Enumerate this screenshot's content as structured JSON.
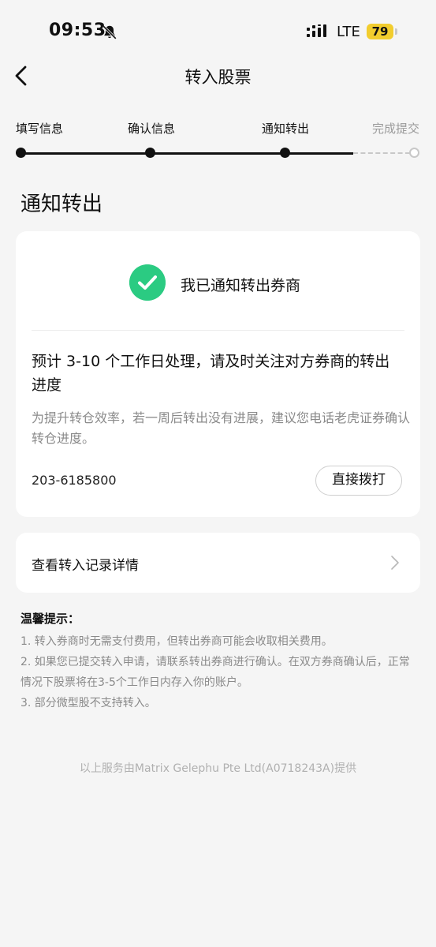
{
  "status_bar": {
    "time": "09:53",
    "network": "LTE",
    "battery": "79"
  },
  "nav": {
    "title": "转入股票"
  },
  "steps": [
    {
      "label": "填写信息",
      "state": "done"
    },
    {
      "label": "确认信息",
      "state": "done"
    },
    {
      "label": "通知转出",
      "state": "current"
    },
    {
      "label": "完成提交",
      "state": "pending"
    }
  ],
  "section_title": "通知转出",
  "notice_card": {
    "confirm_text": "我已通知转出券商",
    "headline": "预计 3-10 个工作日处理，请及时关注对方券商的转出进度",
    "description": "为提升转仓效率，若一周后转出没有进展，建议您电话老虎证券确认转仓进度。",
    "phone": "203-6185800",
    "call_button": "直接拨打"
  },
  "record_link": {
    "label": "查看转入记录详情"
  },
  "tips": {
    "title": "温馨提示：",
    "items": [
      "1. 转入券商时无需支付费用，但转出券商可能会收取相关费用。",
      "2. 如果您已提交转入申请，请联系转出券商进行确认。在双方券商确认后，正常情况下股票将在3-5个工作日内存入你的账户。",
      "3. 部分微型股不支持转入。"
    ]
  },
  "footer": "以上服务由Matrix Gelephu Pte Ltd(A0718243A)提供",
  "colors": {
    "success": "#2bcb82",
    "battery": "#f2cd2e",
    "background": "#f5f5f5"
  }
}
